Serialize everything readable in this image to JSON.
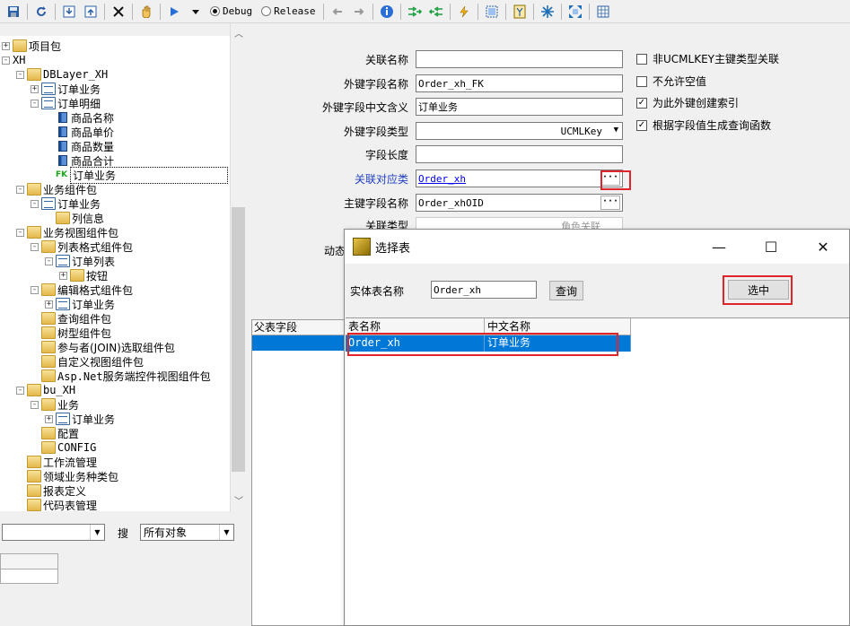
{
  "toolbar": {
    "debug_label": "Debug",
    "release_label": "Release",
    "selected_config": "Debug",
    "icons": [
      "save-icon",
      "refresh-icon",
      "import-icon",
      "export-icon",
      "close-icon",
      "hand-icon",
      "run-icon",
      "dropdown-icon",
      "back-icon",
      "forward-icon",
      "info-icon",
      "merge-right-icon",
      "merge-left-icon",
      "lightning-icon",
      "frame-icon",
      "script-icon",
      "snowflake-icon",
      "expand-icon",
      "table-icon"
    ]
  },
  "tree": {
    "nodes": [
      {
        "label": "项目包",
        "expander": "+",
        "icon": "folder"
      },
      {
        "label": "XH",
        "expander": "−",
        "icon": ""
      },
      {
        "label": "DBLayer_XH",
        "expander": "−",
        "icon": "db"
      },
      {
        "label": "订单业务",
        "expander": "+",
        "icon": "doc"
      },
      {
        "label": "订单明细",
        "expander": "−",
        "icon": "doc"
      },
      {
        "label": "商品名称",
        "expander": "",
        "icon": "field"
      },
      {
        "label": "商品单价",
        "expander": "",
        "icon": "field"
      },
      {
        "label": "商品数量",
        "expander": "",
        "icon": "field"
      },
      {
        "label": "商品合计",
        "expander": "",
        "icon": "field"
      },
      {
        "label": "订单业务",
        "expander": "",
        "icon": "fk",
        "selected": true
      },
      {
        "label": "业务组件包",
        "expander": "−",
        "icon": "bundle"
      },
      {
        "label": "订单业务",
        "expander": "−",
        "icon": "doc"
      },
      {
        "label": "列信息",
        "expander": "",
        "icon": "col"
      },
      {
        "label": "业务视图组件包",
        "expander": "−",
        "icon": "bundle"
      },
      {
        "label": "列表格式组件包",
        "expander": "−",
        "icon": "folder"
      },
      {
        "label": "订单列表",
        "expander": "−",
        "icon": "grid"
      },
      {
        "label": "按钮",
        "expander": "+",
        "icon": "btn"
      },
      {
        "label": "编辑格式组件包",
        "expander": "−",
        "icon": "folder"
      },
      {
        "label": "订单业务",
        "expander": "+",
        "icon": "grid"
      },
      {
        "label": "查询组件包",
        "expander": "",
        "icon": "folder"
      },
      {
        "label": "树型组件包",
        "expander": "",
        "icon": "folder"
      },
      {
        "label": "参与者(JOIN)选取组件包",
        "expander": "",
        "icon": "folder"
      },
      {
        "label": "自定义视图组件包",
        "expander": "",
        "icon": "folder"
      },
      {
        "label": "Asp.Net服务端控件视图组件包",
        "expander": "",
        "icon": "folder"
      },
      {
        "label": "bu_XH",
        "expander": "−",
        "icon": "bu"
      },
      {
        "label": "业务",
        "expander": "−",
        "icon": "folder"
      },
      {
        "label": "订单业务",
        "expander": "+",
        "icon": "doc"
      },
      {
        "label": "配置",
        "expander": "",
        "icon": "folder"
      },
      {
        "label": "CONFIG",
        "expander": "",
        "icon": "folder"
      },
      {
        "label": "工作流管理",
        "expander": "",
        "icon": "flow"
      },
      {
        "label": "领域业务种类包",
        "expander": "",
        "icon": "domain"
      },
      {
        "label": "报表定义",
        "expander": "",
        "icon": "folder"
      },
      {
        "label": "代码表管理",
        "expander": "",
        "icon": "folder"
      }
    ]
  },
  "search": {
    "field_value": "",
    "search_label": "搜",
    "scope_value": "所有对象"
  },
  "properties": {
    "relation_name_label": "关联名称",
    "relation_name_value": "",
    "fk_field_label": "外键字段名称",
    "fk_field_value": "Order_xh_FK",
    "fk_cn_label": "外键字段中文含义",
    "fk_cn_value": "订单业务",
    "fk_type_label": "外键字段类型",
    "fk_type_value": "UCMLKey",
    "length_label": "字段长度",
    "length_value": "",
    "related_class_label": "关联对应类",
    "related_class_value": "Order_xh",
    "pk_field_label": "主键字段名称",
    "pk_field_value": "Order_xhOID",
    "relation_type_label": "关联类型",
    "relation_type_value": "角色关联",
    "dynamic_label": "动态",
    "ellipsis": "···",
    "checkboxes": [
      {
        "label": "非UCMLKEY主键类型关联",
        "checked": false
      },
      {
        "label": "不允许空值",
        "checked": false
      },
      {
        "label": "为此外键创建索引",
        "checked": true
      },
      {
        "label": "根据字段值生成查询函数",
        "checked": true
      }
    ]
  },
  "lower_grid": {
    "header": "父表字段"
  },
  "dialog": {
    "title": "选择表",
    "entity_label": "实体表名称",
    "entity_value": "Order_xh",
    "query_button": "查询",
    "select_button": "选中",
    "columns": [
      "表名称",
      "中文名称"
    ],
    "rows": [
      {
        "table": "Order_xh",
        "cn": "订单业务"
      }
    ],
    "minimize": "—",
    "maximize": "☐",
    "close": "✕"
  }
}
